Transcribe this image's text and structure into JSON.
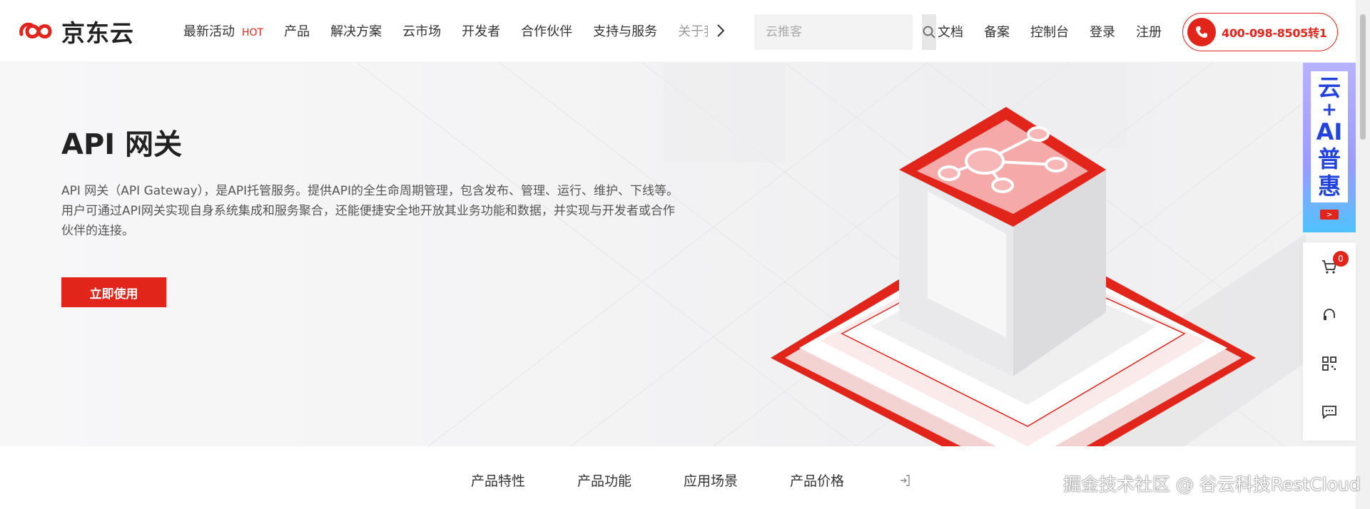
{
  "brand": {
    "name": "京东云",
    "accent": "#e1251b"
  },
  "nav": {
    "items": [
      {
        "label": "最新活动",
        "badge": "HOT"
      },
      {
        "label": "产品"
      },
      {
        "label": "解决方案"
      },
      {
        "label": "云市场"
      },
      {
        "label": "开发者"
      },
      {
        "label": "合作伙伴"
      },
      {
        "label": "支持与服务"
      },
      {
        "label": "关于我"
      }
    ],
    "more_icon": "chevron-right-icon"
  },
  "search": {
    "placeholder": "云推客",
    "icon": "search-icon"
  },
  "header_links": [
    "文档",
    "备案",
    "控制台",
    "登录",
    "注册"
  ],
  "phone": {
    "number": "400-098-8505转1",
    "icon": "phone-icon"
  },
  "hero": {
    "title": "API 网关",
    "description_line1": "API 网关（API Gateway），是API托管服务。提供API的全生命周期管理，包含发布、管理、运行、维护、下线等。",
    "description_line2": "用户可通过API网关实现自身系统集成和服务聚合，还能便捷安全地开放其业务功能和数据，并实现与开发者或合作",
    "description_line3": "伙伴的连接。",
    "cta": "立即使用"
  },
  "promo": {
    "chars": [
      "云",
      "+",
      "AI",
      "普",
      "惠"
    ],
    "arrow": ">"
  },
  "sidebar": {
    "cart_count": "0",
    "icons": [
      "cart-icon",
      "headset-icon",
      "qrcode-icon",
      "chat-icon"
    ]
  },
  "subnav": [
    "产品特性",
    "产品功能",
    "应用场景",
    "产品价格"
  ],
  "watermark": "掘金技术社区 @ 谷云科技RestCloud"
}
